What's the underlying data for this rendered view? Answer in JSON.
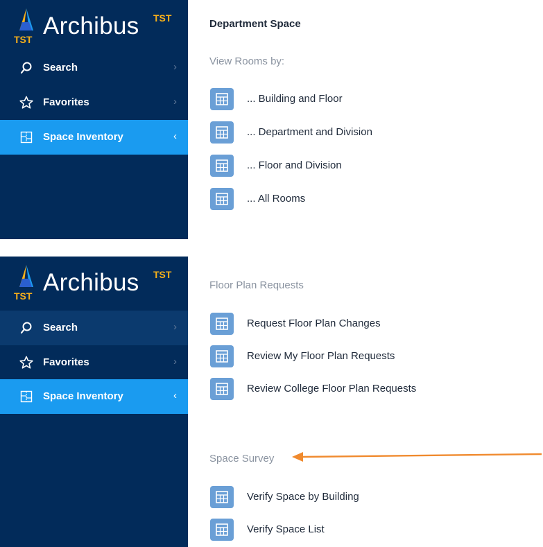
{
  "brand": {
    "name": "Archibus",
    "superscript": "TST",
    "mark": "TST"
  },
  "nav": {
    "search": "Search",
    "favorites": "Favorites",
    "space_inventory": "Space Inventory",
    "chevron_right": "›",
    "chevron_left": "‹"
  },
  "top": {
    "title": "Department Space",
    "section": "View Rooms by:",
    "tasks": [
      "... Building and Floor",
      "... Department and Division",
      "... Floor and Division",
      "... All Rooms"
    ]
  },
  "bottom": {
    "section1": "Floor Plan Requests",
    "tasks1": [
      "Request Floor Plan Changes",
      "Review My Floor Plan Requests",
      "Review College Floor Plan Requests"
    ],
    "section2": "Space Survey",
    "tasks2": [
      "Verify Space by Building",
      "Verify Space List"
    ]
  },
  "colors": {
    "sidebar": "#022b5a",
    "active": "#1a9bf0",
    "accent": "#f6b01a",
    "task_icon": "#6a9fd6",
    "annotation_arrow": "#f08a2e"
  },
  "icons": {
    "search": "search-icon",
    "favorites": "star-icon",
    "space_inventory": "floorplan-icon",
    "task": "table-icon"
  }
}
